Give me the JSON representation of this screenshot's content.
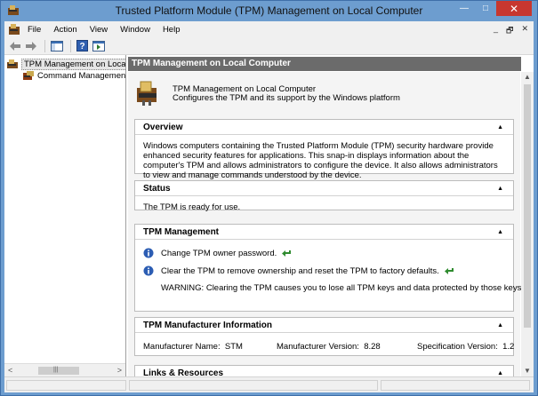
{
  "window": {
    "title": "Trusted Platform Module (TPM) Management on Local Computer",
    "minimize": "—",
    "maximize": "□",
    "close": "✕"
  },
  "menu": {
    "items": [
      "File",
      "Action",
      "View",
      "Window",
      "Help"
    ],
    "mdi_minimize": "_",
    "mdi_restore": "🗗",
    "mdi_close": "✕"
  },
  "toolbar": {
    "buttons": [
      "back-icon",
      "forward-icon",
      "show-hide-tree-icon",
      "help-icon",
      "show-action-pane-icon"
    ]
  },
  "tree": {
    "root_label": "TPM Management on Local Computer",
    "child_label": "Command Management",
    "scroll_left": "<",
    "scroll_right": ">",
    "scroll_grip": "|||"
  },
  "content": {
    "header": "TPM Management on Local Computer",
    "intro_title": "TPM Management on Local Computer",
    "intro_subtitle": "Configures the TPM and its support by the Windows platform",
    "collapse_glyph": "▲",
    "scroll_up": "▲",
    "scroll_down": "▼",
    "overview": {
      "title": "Overview",
      "body": "Windows computers containing the Trusted Platform Module (TPM) security hardware provide enhanced security features for applications. This snap-in displays information about the computer's TPM and allows administrators to configure the device. It also allows administrators to view and manage commands understood by the device."
    },
    "status": {
      "title": "Status",
      "body": "The TPM is ready for use."
    },
    "tpm_management": {
      "title": "TPM Management",
      "action1": "Change TPM owner password.",
      "action2": "Clear the TPM to remove ownership and reset the TPM to factory defaults.",
      "warning": "WARNING: Clearing the TPM causes you to lose all TPM keys and data protected by those keys."
    },
    "manufacturer": {
      "title": "TPM Manufacturer Information",
      "name_label": "Manufacturer Name:",
      "name_value": "STM",
      "version_label": "Manufacturer Version:",
      "version_value": "8.28",
      "spec_label": "Specification Version:",
      "spec_value": "1.2"
    },
    "links": {
      "title": "Links & Resources"
    }
  },
  "colors": {
    "titlebar": "#6d9dcf",
    "close_button": "#c7372f",
    "content_header": "#6b6b6b"
  }
}
